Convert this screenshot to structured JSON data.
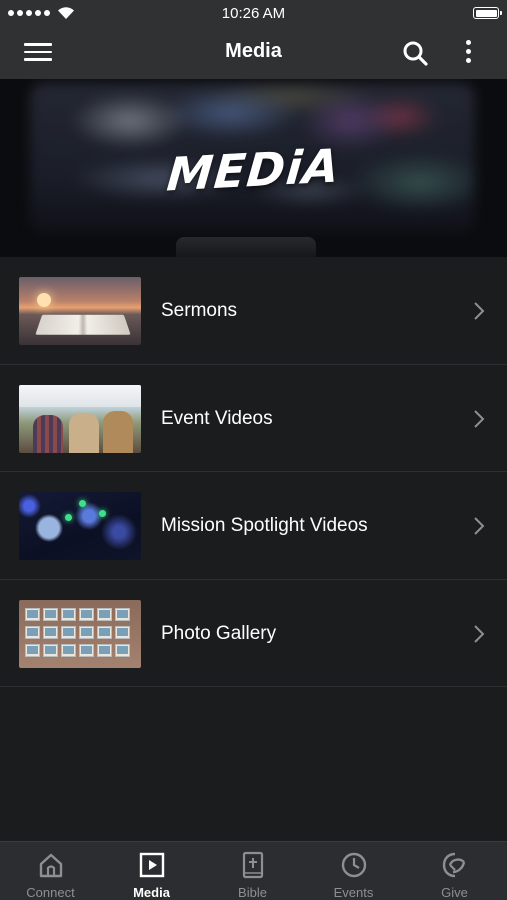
{
  "status_bar": {
    "time": "10:26 AM"
  },
  "nav": {
    "title": "Media"
  },
  "hero": {
    "title": "MEDiA"
  },
  "media_items": [
    {
      "label": "Sermons",
      "thumb": "sunset-open-bible"
    },
    {
      "label": "Event Videos",
      "thumb": "crowd-outdoor-event"
    },
    {
      "label": "Mission Spotlight Videos",
      "thumb": "concert-disco-ball"
    },
    {
      "label": "Photo Gallery",
      "thumb": "printed-photos-table"
    }
  ],
  "tabs": [
    {
      "label": "Connect",
      "icon": "home-icon",
      "active": false
    },
    {
      "label": "Media",
      "icon": "play-icon",
      "active": true
    },
    {
      "label": "Bible",
      "icon": "bible-icon",
      "active": false
    },
    {
      "label": "Events",
      "icon": "clock-icon",
      "active": false
    },
    {
      "label": "Give",
      "icon": "give-icon",
      "active": false
    }
  ],
  "colors": {
    "background": "#1b1c1e",
    "bar": "#303133",
    "tab_bar": "#2c2d30",
    "inactive_tab": "#8e8f92"
  }
}
